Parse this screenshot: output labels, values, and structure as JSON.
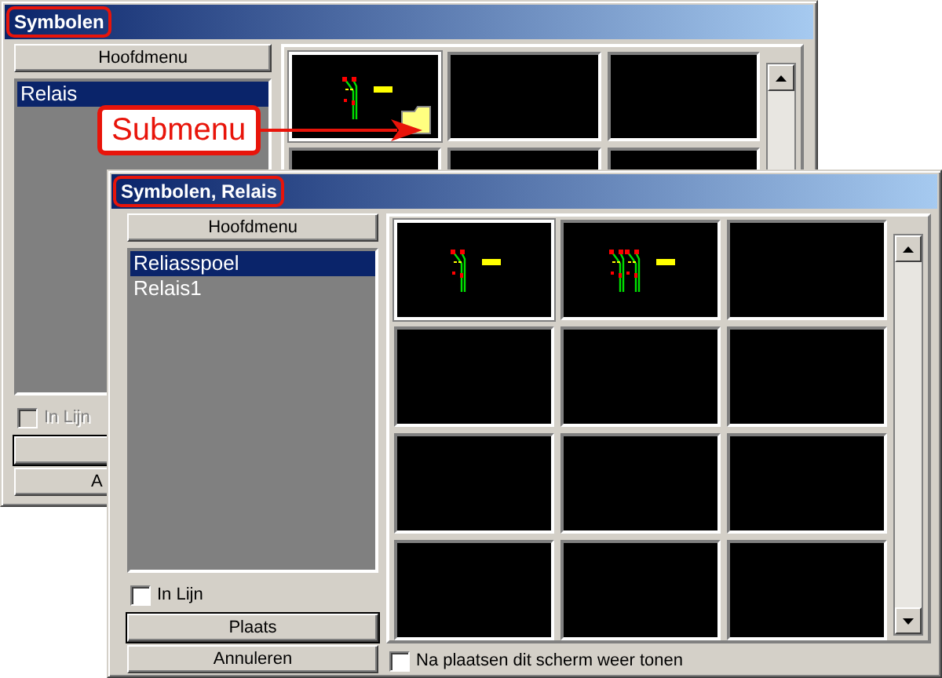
{
  "back_window": {
    "title": "Symbolen",
    "title_marked": true,
    "menu_button": "Hoofdmenu",
    "list": [
      {
        "label": "Relais",
        "selected": true
      }
    ],
    "inline_checkbox": {
      "label": "In Lijn",
      "checked": false,
      "disabled": true
    },
    "buttons": [
      {
        "kind": "default"
      },
      {
        "kind": "normal",
        "label": "A"
      }
    ],
    "tiles": [
      {
        "kind": "submenu",
        "selected": true
      },
      {
        "kind": "empty",
        "selected": false
      },
      {
        "kind": "empty",
        "selected": false
      },
      {
        "kind": "empty",
        "selected": false
      },
      {
        "kind": "empty",
        "selected": false
      },
      {
        "kind": "empty",
        "selected": false
      }
    ]
  },
  "callout": {
    "text": "Submenu"
  },
  "front_window": {
    "title": "Symbolen, Relais",
    "title_marked": true,
    "menu_button": "Hoofdmenu",
    "list": [
      {
        "label": "Reliasspoel",
        "selected": true
      },
      {
        "label": "Relais1",
        "selected": false
      }
    ],
    "inline_checkbox": {
      "label": "In Lijn",
      "checked": false,
      "disabled": false
    },
    "buttons": [
      {
        "kind": "default",
        "label": "Plaats"
      },
      {
        "kind": "normal",
        "label": "Annuleren"
      }
    ],
    "tiles": [
      {
        "kind": "single",
        "selected": true
      },
      {
        "kind": "double",
        "selected": false
      },
      {
        "kind": "empty",
        "selected": false
      },
      {
        "kind": "empty",
        "selected": false
      },
      {
        "kind": "empty",
        "selected": false
      },
      {
        "kind": "empty",
        "selected": false
      },
      {
        "kind": "empty",
        "selected": false
      },
      {
        "kind": "empty",
        "selected": false
      },
      {
        "kind": "empty",
        "selected": false
      },
      {
        "kind": "empty",
        "selected": false
      },
      {
        "kind": "empty",
        "selected": false
      },
      {
        "kind": "empty",
        "selected": false
      }
    ],
    "show_again_checkbox": {
      "label": "Na plaatsen dit scherm weer tonen",
      "checked": false
    }
  }
}
